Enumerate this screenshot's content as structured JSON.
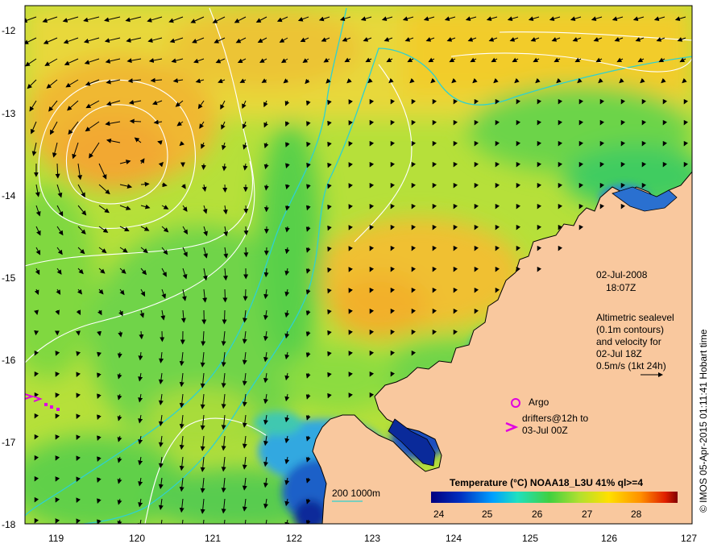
{
  "map": {
    "date": "02-Jul-2008",
    "time": "18:07Z",
    "altimetry_lines": [
      "Altimetric sealevel",
      "(0.1m contours)",
      "and velocity for",
      "02-Jul 18Z",
      "0.5m/s (1kt 24h)"
    ],
    "argo_label": "Argo",
    "drifters_lines": [
      "drifters@12h to",
      "03-Jul 00Z"
    ],
    "depth_label": "200  1000m",
    "colorbar_title": "Temperature (°C) NOAA18_L3U 41% ql>=4",
    "colorbar_ticks": [
      "24",
      "25",
      "26",
      "27",
      "28"
    ],
    "credit": "© IMOS 05-Apr-2015 01:11:41 Hobart time",
    "lat_ticks": [
      "-12",
      "-13",
      "-14",
      "-15",
      "-16",
      "-17",
      "-18"
    ],
    "lon_ticks": [
      "119",
      "120",
      "121",
      "122",
      "123",
      "124",
      "125",
      "126",
      "127"
    ],
    "colors": {
      "land": "#f9c89e",
      "sst_warm": "#f4c02c",
      "sst_mid": "#b9e03a",
      "sst_cool": "#4ad24e",
      "sst_cold": "#1c44b8",
      "contour": "#ffffff",
      "isobath": "#2fd1cf",
      "argo_drifter": "#e000e0"
    }
  }
}
